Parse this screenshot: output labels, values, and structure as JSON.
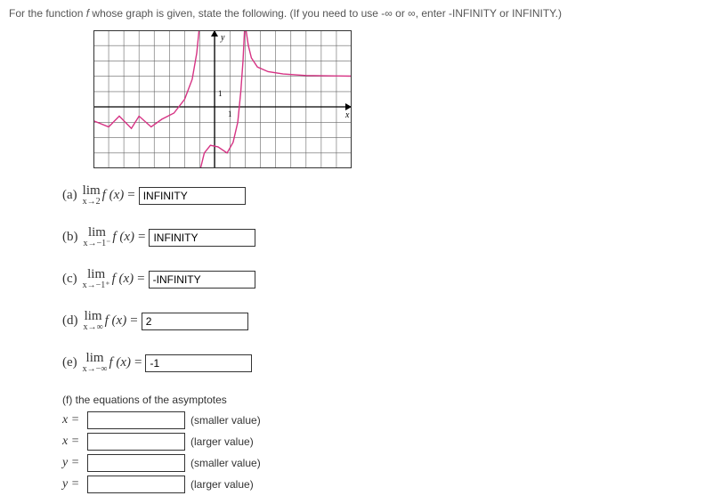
{
  "intro_prefix": "For the function ",
  "intro_fn": "f",
  "intro_mid": " whose graph is given, state the following. (If you need to use -∞ or ∞, enter -INFINITY or INFINITY.)",
  "axis_y_label": "y",
  "axis_x_label": "x",
  "tick_one_y": "1",
  "tick_one_x": "1",
  "items": {
    "a": {
      "letter": "(a)",
      "approach": "x→2",
      "value": "INFINITY"
    },
    "b": {
      "letter": "(b)",
      "approach": "x→−1⁻",
      "value": "INFINITY"
    },
    "c": {
      "letter": "(c)",
      "approach": "x→−1⁺",
      "value": "-INFINITY"
    },
    "d": {
      "letter": "(d)",
      "approach": "x→∞",
      "value": "2"
    },
    "e": {
      "letter": "(e)",
      "approach": "x→−∞",
      "value": "-1"
    }
  },
  "lim_word": "lim",
  "fx_text": "f (x)",
  "equals": "=",
  "asym": {
    "title": "(f) the equations of the asymptotes",
    "rows": [
      {
        "var": "x =",
        "note": "(smaller value)",
        "value": ""
      },
      {
        "var": "x =",
        "note": "(larger value)",
        "value": ""
      },
      {
        "var": "y =",
        "note": "(smaller value)",
        "value": ""
      },
      {
        "var": "y =",
        "note": "(larger value)",
        "value": ""
      }
    ]
  },
  "chart_data": {
    "type": "line",
    "title": "",
    "xlabel": "x",
    "ylabel": "y",
    "xlim": [
      -8,
      9
    ],
    "ylim": [
      -4,
      5
    ],
    "grid": true,
    "horizontal_asymptote_left": -1,
    "horizontal_asymptote_right": 2,
    "vertical_asymptotes": [
      -1,
      2
    ],
    "segments": [
      {
        "name": "left_branch",
        "points": [
          [
            -8,
            -0.9
          ],
          [
            -7,
            -1.3
          ],
          [
            -6.3,
            -0.6
          ],
          [
            -5.5,
            -1.4
          ],
          [
            -5.0,
            -0.6
          ],
          [
            -4.2,
            -1.3
          ],
          [
            -3.5,
            -0.8
          ],
          [
            -2.7,
            -0.4
          ],
          [
            -2.0,
            0.5
          ],
          [
            -1.5,
            1.8
          ],
          [
            -1.2,
            3.5
          ],
          [
            -1.05,
            5.0
          ]
        ]
      },
      {
        "name": "middle_branch",
        "points": [
          [
            -0.95,
            -4.0
          ],
          [
            -0.7,
            -3.0
          ],
          [
            -0.3,
            -2.5
          ],
          [
            0.2,
            -2.6
          ],
          [
            0.8,
            -3.0
          ],
          [
            1.2,
            -2.3
          ],
          [
            1.5,
            -1.0
          ],
          [
            1.7,
            1.0
          ],
          [
            1.85,
            3.0
          ],
          [
            1.95,
            5.0
          ]
        ]
      },
      {
        "name": "right_branch",
        "points": [
          [
            2.05,
            5.0
          ],
          [
            2.2,
            4.0
          ],
          [
            2.4,
            3.2
          ],
          [
            2.8,
            2.6
          ],
          [
            3.5,
            2.3
          ],
          [
            4.5,
            2.15
          ],
          [
            6.0,
            2.05
          ],
          [
            8.0,
            2.02
          ],
          [
            9.0,
            2.01
          ]
        ]
      }
    ]
  }
}
